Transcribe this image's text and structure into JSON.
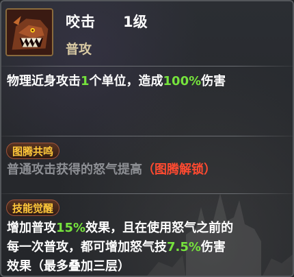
{
  "skill": {
    "name": "咬击",
    "level": "1级",
    "type": "普攻",
    "icon": "beast-bite-icon",
    "desc": {
      "p1": "物理近身攻击",
      "num1": "1",
      "p2": "个单位，造成",
      "num2": "100%",
      "p3": "伤害"
    }
  },
  "totem": {
    "title": "图腾共鸣",
    "text": "普通攻击获得的怒气提高",
    "lock": "（图腾解锁）"
  },
  "awaken": {
    "title": "技能觉醒",
    "line1_a": "增加普攻",
    "line1_pct": "15%",
    "line1_b": "效果，且在使用怒气之前的",
    "line2_a": "每一次普攻，都可增加怒气技",
    "line2_pct": "7.5%",
    "line2_b": "伤害",
    "line3": "效果（最多叠加三层）"
  },
  "colors": {
    "highlight_green": "#76e33d",
    "highlight_red": "#ff4a30",
    "badge_gold": "#ffc83a",
    "type_tan": "#d7c8a2"
  }
}
